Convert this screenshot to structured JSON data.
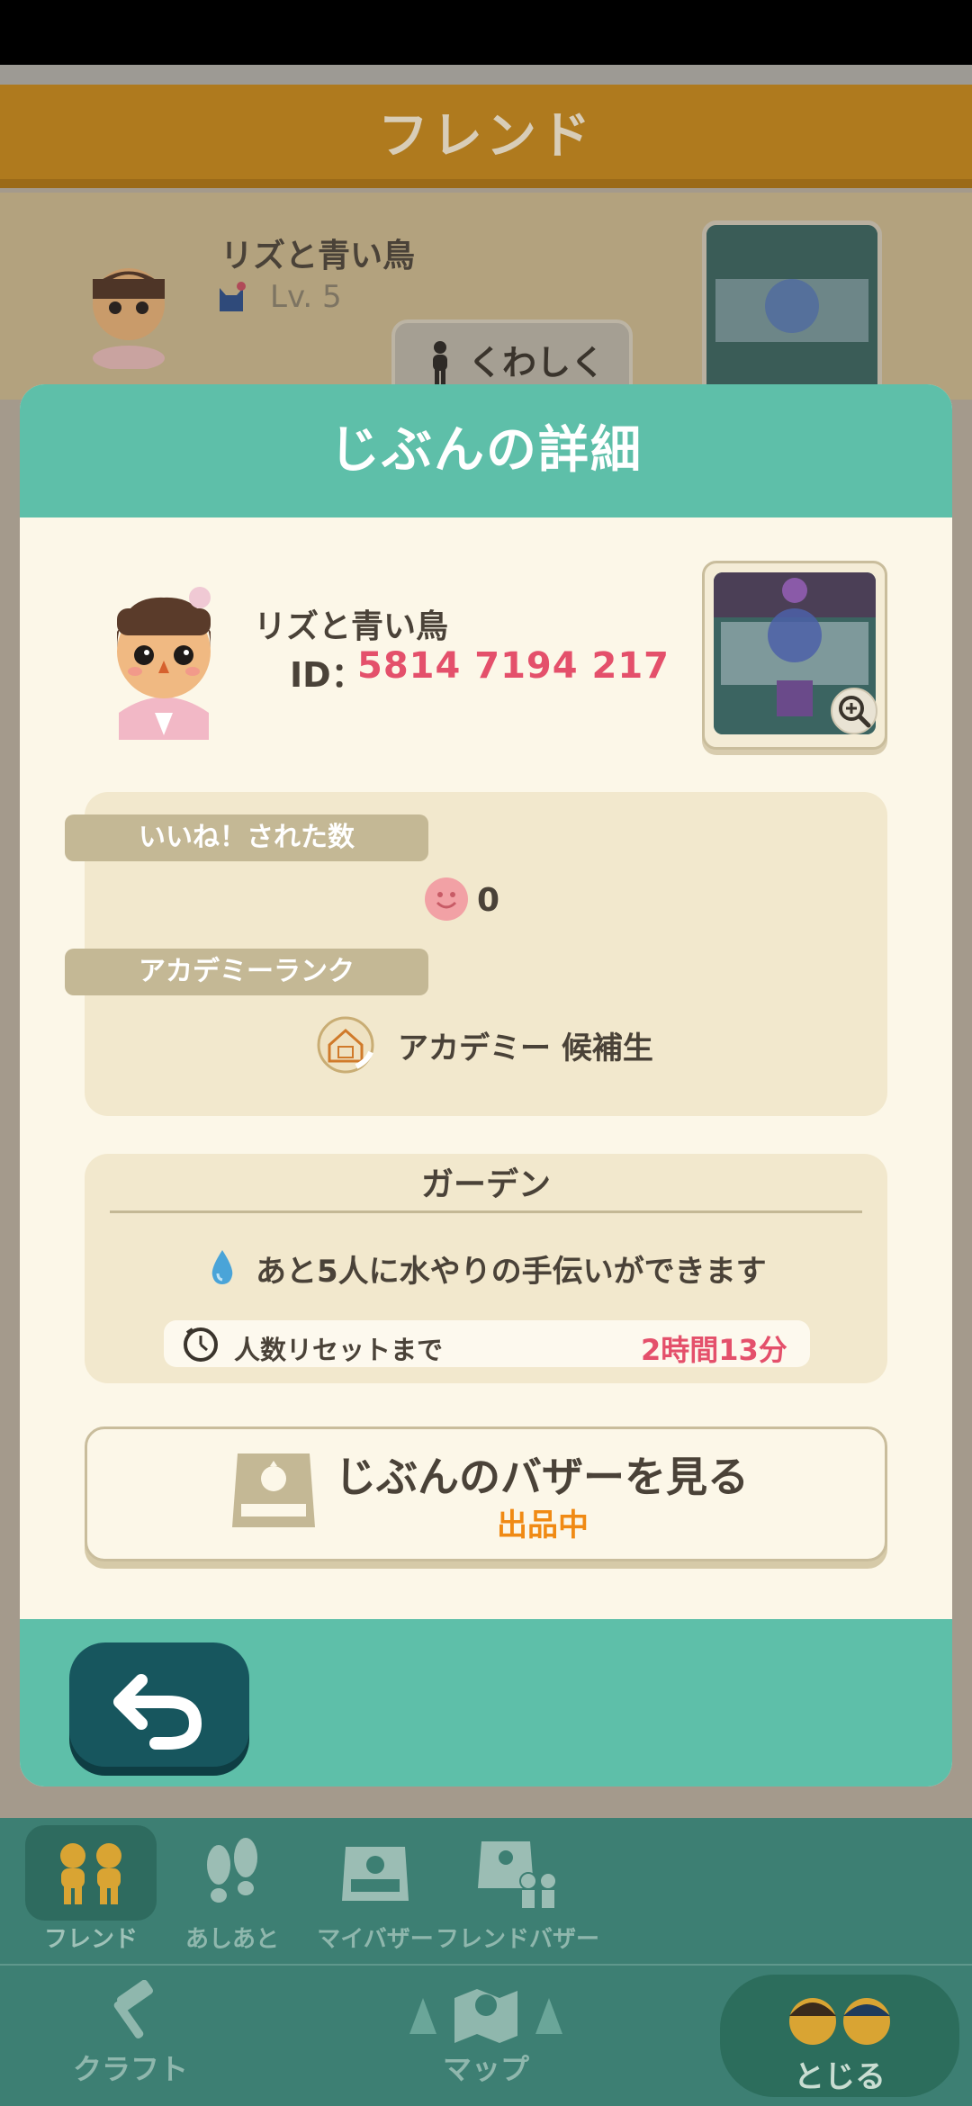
{
  "background": {
    "header_title": "フレンド",
    "friend_name": "リズと青い鳥",
    "friend_level": "Lv. 5",
    "detail_button": "くわしく"
  },
  "modal": {
    "title": "じぶんの詳細",
    "profile": {
      "name": "リズと青い鳥",
      "id_label": "ID：",
      "id_value": "5814 7194 217"
    },
    "stats": {
      "likes_label": "いいね！された数",
      "likes_value": "0",
      "rank_label": "アカデミーランク",
      "rank_value": "アカデミー 候補生"
    },
    "garden": {
      "title": "ガーデン",
      "message": "あと5人に水やりの手伝いができます",
      "reset_label": "人数リセットまで",
      "reset_value": "2時間13分"
    },
    "bazaar": {
      "label": "じぶんのバザーを見る",
      "status": "出品中"
    }
  },
  "nav": {
    "tabs": [
      {
        "label": "フレンド",
        "icon": "friends-icon",
        "active": true
      },
      {
        "label": "あしあと",
        "icon": "footprints-icon"
      },
      {
        "label": "マイバザー",
        "icon": "bazaar-icon"
      },
      {
        "label": "フレンドバザー",
        "icon": "friend-bazaar-icon"
      }
    ],
    "craft": "クラフト",
    "map": "マップ",
    "close": "とじる"
  },
  "colors": {
    "teal": "#5ebfa9",
    "accent_red": "#e4506b",
    "accent_orange": "#f08a14",
    "cream": "#fcf7e8",
    "back_button": "#17565e"
  }
}
